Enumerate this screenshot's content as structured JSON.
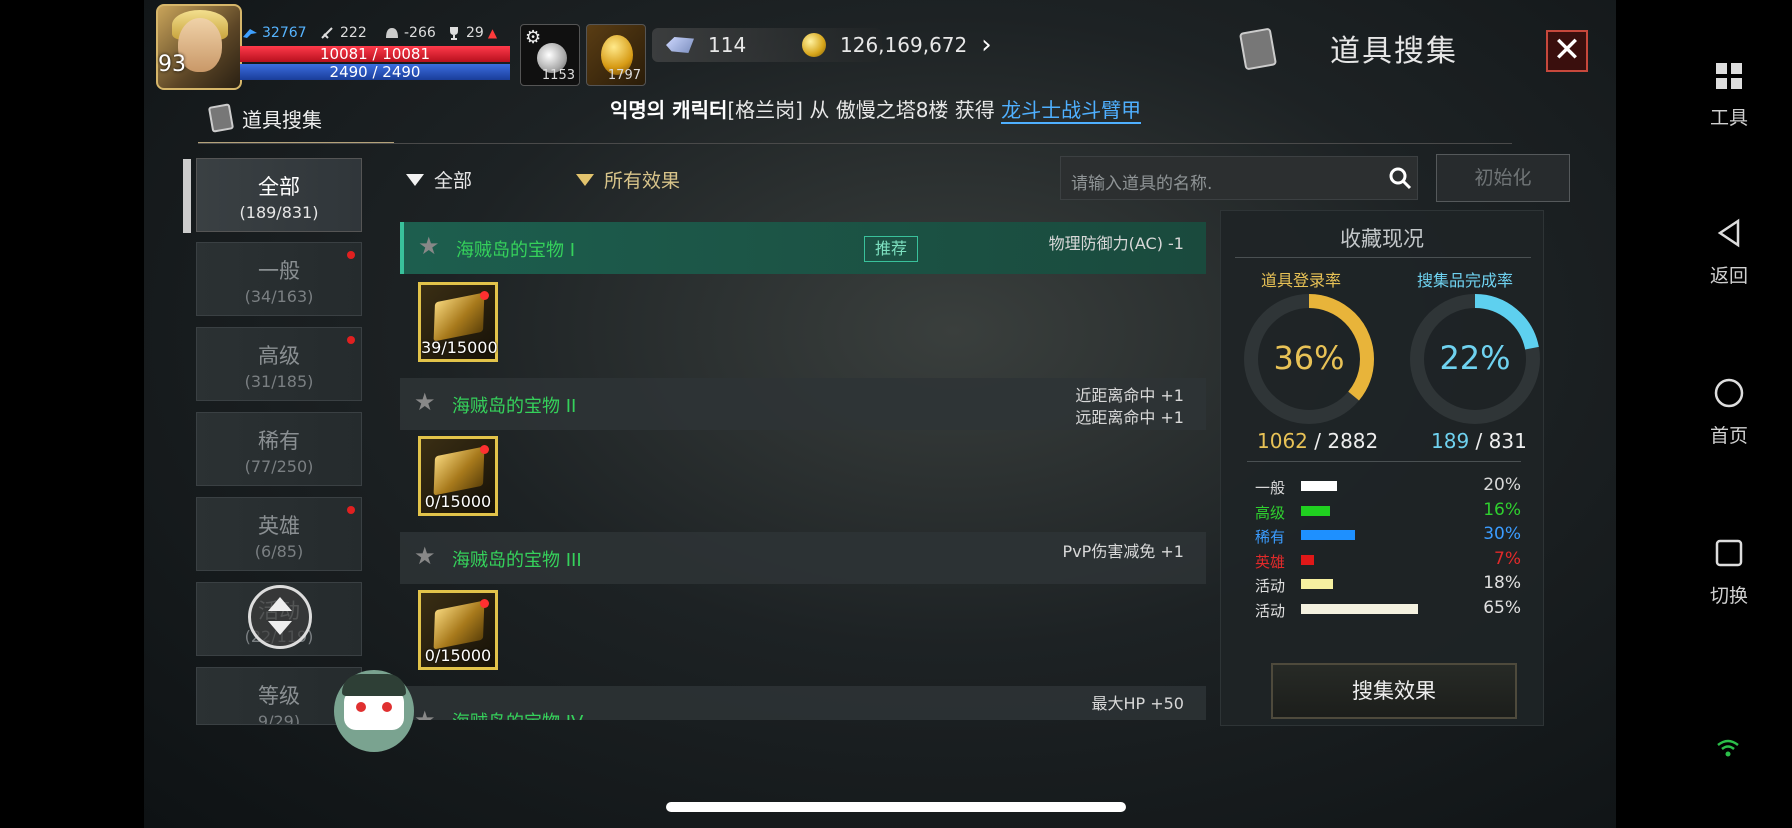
{
  "hud": {
    "level": "93",
    "power": "32767",
    "attack": "222",
    "defense": "-266",
    "trophy": "29",
    "hp": "10081 / 10081",
    "mp": "2490 / 2490",
    "potion_count": "1153",
    "seed_count": "1797",
    "crystal": "114",
    "gold": "126,169,672"
  },
  "window": {
    "title": "道具搜集",
    "close_label": "✕"
  },
  "tab_header": {
    "label": "道具搜集"
  },
  "notice": {
    "prefix": "익명의 캐릭터",
    "name": "[格兰岗]",
    "middle": " 从 傲慢之塔8楼 获得 ",
    "item": "龙斗士战斗臂甲"
  },
  "categories": [
    {
      "name": "全部",
      "count": "(189/831)"
    },
    {
      "name": "一般",
      "count": "(34/163)"
    },
    {
      "name": "高级",
      "count": "(31/185)"
    },
    {
      "name": "稀有",
      "count": "(77/250)"
    },
    {
      "name": "英雄",
      "count": "(6/85)"
    },
    {
      "name": "活动",
      "count": "(22/119)"
    },
    {
      "name": "等级",
      "count": "9/29)"
    }
  ],
  "filters": {
    "category": "全部",
    "effect": "所有效果"
  },
  "search": {
    "placeholder": "请输入道具的名称.",
    "reset_label": "初始化"
  },
  "rows": [
    {
      "name": "海贼岛的宝物 I",
      "badge": "推荐",
      "effects": [
        "物理防御力(AC) -1"
      ],
      "count": "39/15000"
    },
    {
      "name": "海贼岛的宝物 II",
      "effects": [
        "近距离命中 +1",
        "远距离命中 +1"
      ],
      "count": "0/15000"
    },
    {
      "name": "海贼岛的宝物 III",
      "effects": [
        "PvP伤害减免 +1"
      ],
      "count": "0/15000"
    },
    {
      "name": "海贼岛的宝物 IV",
      "effects": [
        "最大HP +50"
      ]
    }
  ],
  "panel": {
    "title": "收藏现况",
    "left_label": "道具登录率",
    "left_percent": "36%",
    "left_value": 0.36,
    "left_count_a": "1062",
    "left_count_b": " / 2882",
    "right_label": "搜集品完成率",
    "right_percent": "22%",
    "right_value": 0.22,
    "right_count_a": "189",
    "right_count_b": " / 831",
    "stats": [
      {
        "label": "一般",
        "percent": "20%",
        "value": 0.2,
        "color": "#ffffff",
        "label_color": "#d8d8d8",
        "pct_color": "#d8d8d8"
      },
      {
        "label": "高级",
        "percent": "16%",
        "value": 0.16,
        "color": "#20d020",
        "label_color": "#2fd02f",
        "pct_color": "#2fd02f"
      },
      {
        "label": "稀有",
        "percent": "30%",
        "value": 0.3,
        "color": "#1e90ff",
        "label_color": "#3b9cff",
        "pct_color": "#3b9cff"
      },
      {
        "label": "英雄",
        "percent": "7%",
        "value": 0.07,
        "color": "#e01818",
        "label_color": "#e02a2a",
        "pct_color": "#e02a2a"
      },
      {
        "label": "活动",
        "percent": "18%",
        "value": 0.18,
        "color": "#f6f0a0",
        "label_color": "#e0e0e0",
        "pct_color": "#e0e0e0"
      },
      {
        "label": "活动",
        "percent": "65%",
        "value": 0.65,
        "color": "#f4f1e0",
        "label_color": "#e0e0e0",
        "pct_color": "#e0e0e0"
      }
    ],
    "collect_button": "搜集效果"
  },
  "sidebar": {
    "tools": "工具",
    "back": "返回",
    "home": "首页",
    "switch": "切换"
  }
}
